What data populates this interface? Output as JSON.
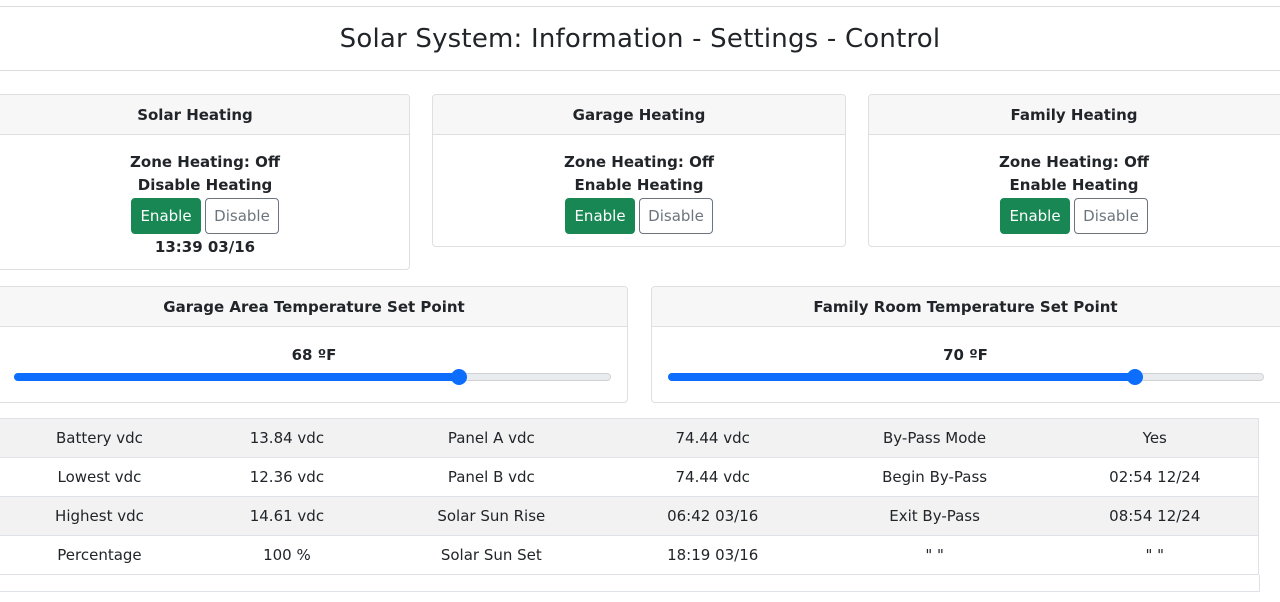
{
  "page": {
    "title": "Solar System: Information - Settings - Control"
  },
  "zones": [
    {
      "name": "Solar Heating",
      "zone_status": "Zone Heating: Off",
      "heat_state": "Disable Heating",
      "enable_label": "Enable",
      "disable_label": "Disable",
      "timestamp": "13:39 03/16"
    },
    {
      "name": "Garage Heating",
      "zone_status": "Zone Heating: Off",
      "heat_state": "Enable Heating",
      "enable_label": "Enable",
      "disable_label": "Disable"
    },
    {
      "name": "Family Heating",
      "zone_status": "Zone Heating: Off",
      "heat_state": "Enable Heating",
      "enable_label": "Enable",
      "disable_label": "Disable"
    }
  ],
  "setpoints": [
    {
      "title": "Garage Area Temperature Set Point",
      "value_label": "68 ºF",
      "fraction": 0.745
    },
    {
      "title": "Family Room Temperature Set Point",
      "value_label": "70 ºF",
      "fraction": 0.783
    }
  ],
  "table": {
    "rows": [
      [
        "Battery vdc",
        "13.84 vdc",
        "Panel A vdc",
        "74.44 vdc",
        "By-Pass Mode",
        "Yes"
      ],
      [
        "Lowest vdc",
        "12.36 vdc",
        "Panel B vdc",
        "74.44 vdc",
        "Begin By-Pass",
        "02:54 12/24"
      ],
      [
        "Highest vdc",
        "14.61 vdc",
        "Solar Sun Rise",
        "06:42 03/16",
        "Exit By-Pass",
        "08:54 12/24"
      ],
      [
        "Percentage",
        "100 %",
        "Solar Sun Set",
        "18:19 03/16",
        "\" \"",
        "\" \""
      ]
    ]
  },
  "colors": {
    "enable": "#198754",
    "disable_outline": "#6c757d",
    "slider": "#0d6efd"
  }
}
